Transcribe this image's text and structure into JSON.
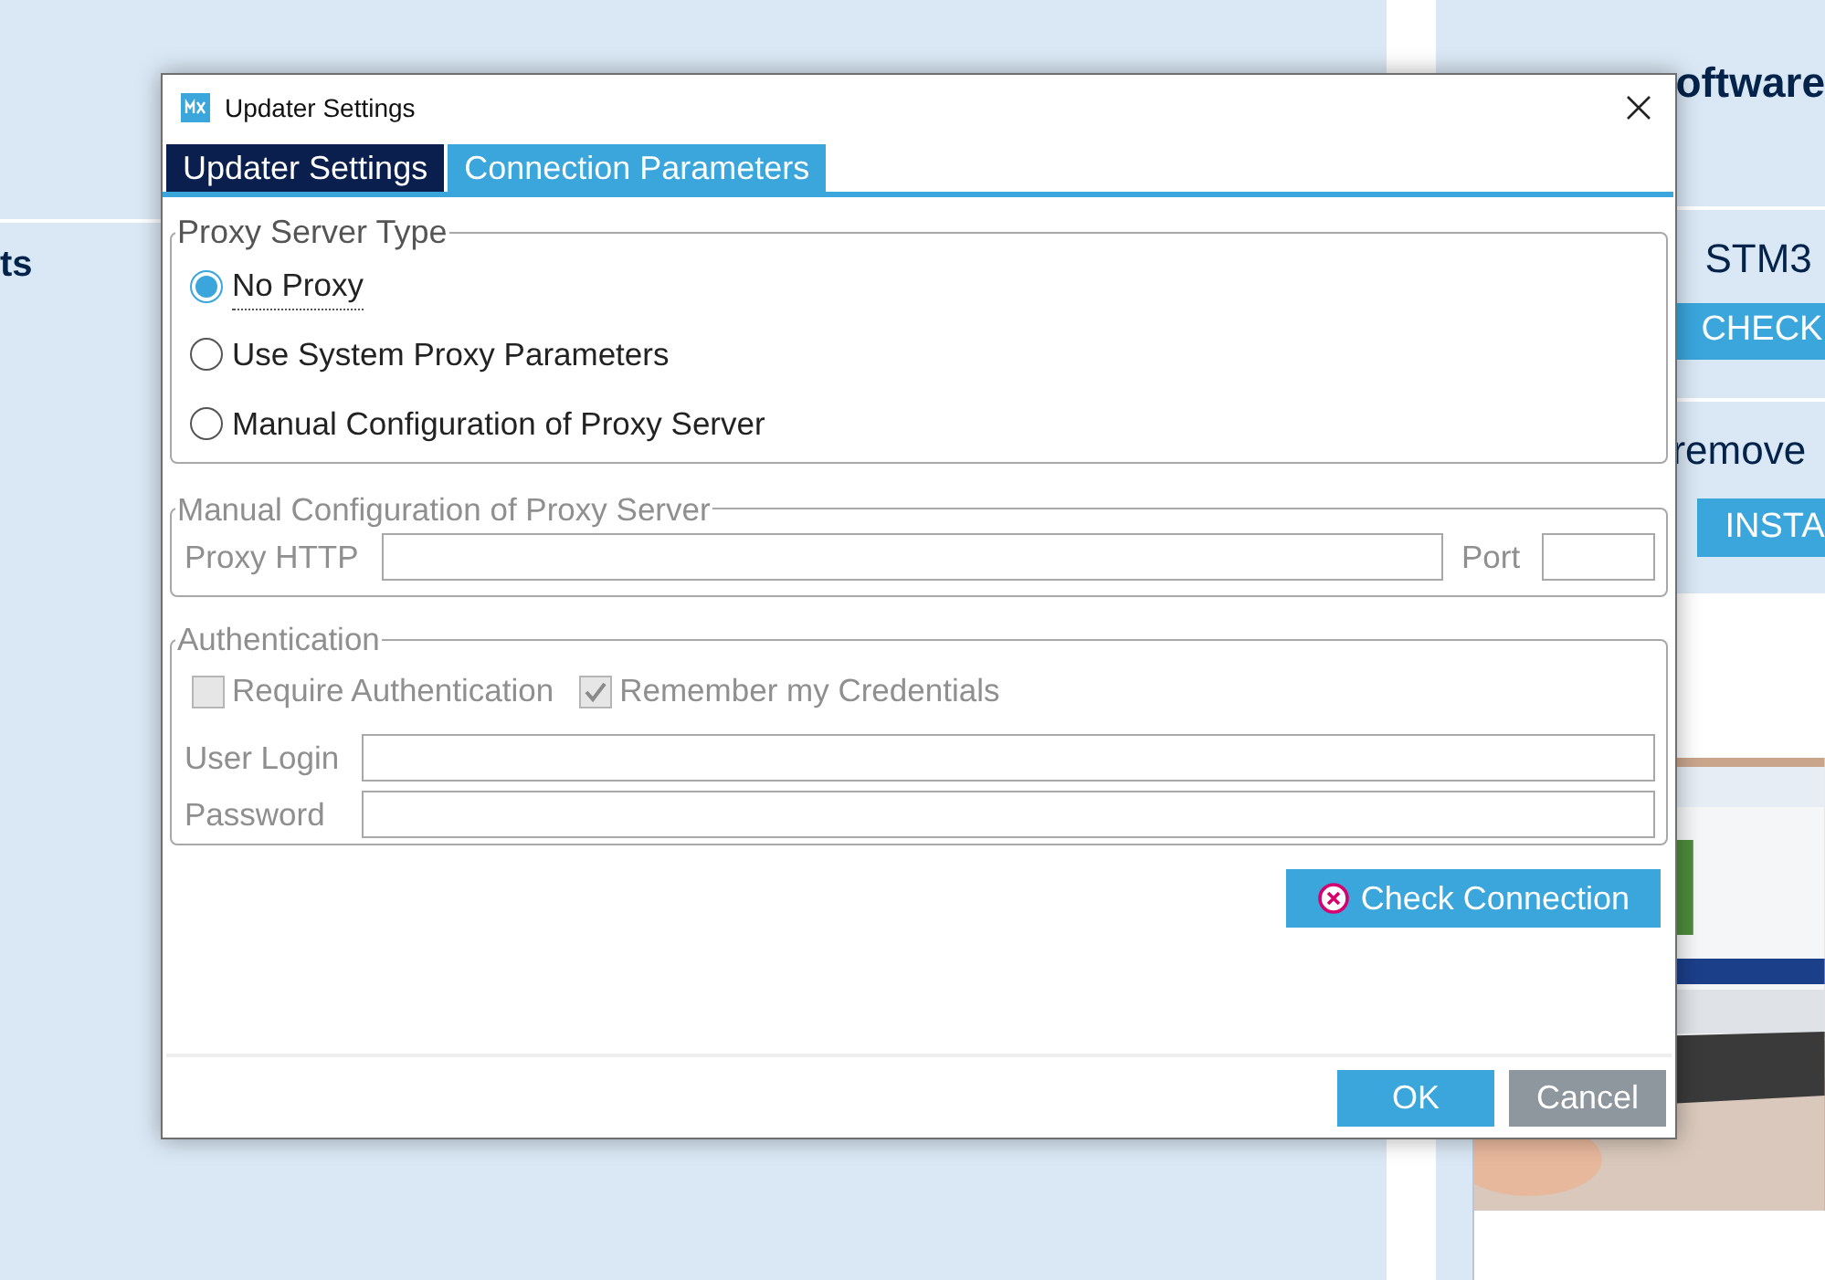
{
  "background": {
    "left": {
      "side_label": "ts"
    },
    "right": {
      "heading": "oftware",
      "section_1_text": "STM3",
      "section_1_button": "CHECK",
      "section_2_text": "remove",
      "section_2_button": "INSTA"
    }
  },
  "dialog": {
    "title": "Updater Settings",
    "tabs": [
      {
        "label": "Updater Settings",
        "selected": false
      },
      {
        "label": "Connection Parameters",
        "selected": true
      }
    ],
    "proxy_type": {
      "legend": "Proxy Server Type",
      "options": [
        {
          "label": "No Proxy",
          "selected": true,
          "focused": true
        },
        {
          "label": "Use System Proxy Parameters",
          "selected": false,
          "focused": false
        },
        {
          "label": "Manual Configuration of Proxy Server",
          "selected": false,
          "focused": false
        }
      ]
    },
    "manual": {
      "legend": "Manual Configuration of Proxy Server",
      "disabled": true,
      "proxy_label": "Proxy HTTP",
      "port_label": "Port"
    },
    "authentication": {
      "legend": "Authentication",
      "disabled": true,
      "checkboxes": [
        {
          "label": "Require Authentication",
          "checked": false
        },
        {
          "label": "Remember my Credentials",
          "checked": true
        }
      ],
      "fields": [
        {
          "label": "User Login"
        },
        {
          "label": "Password"
        }
      ]
    },
    "check_button": {
      "label": "Check Connection"
    },
    "buttons": [
      {
        "label": "OK",
        "kind": "primary"
      },
      {
        "label": "Cancel",
        "kind": "secondary"
      }
    ]
  }
}
